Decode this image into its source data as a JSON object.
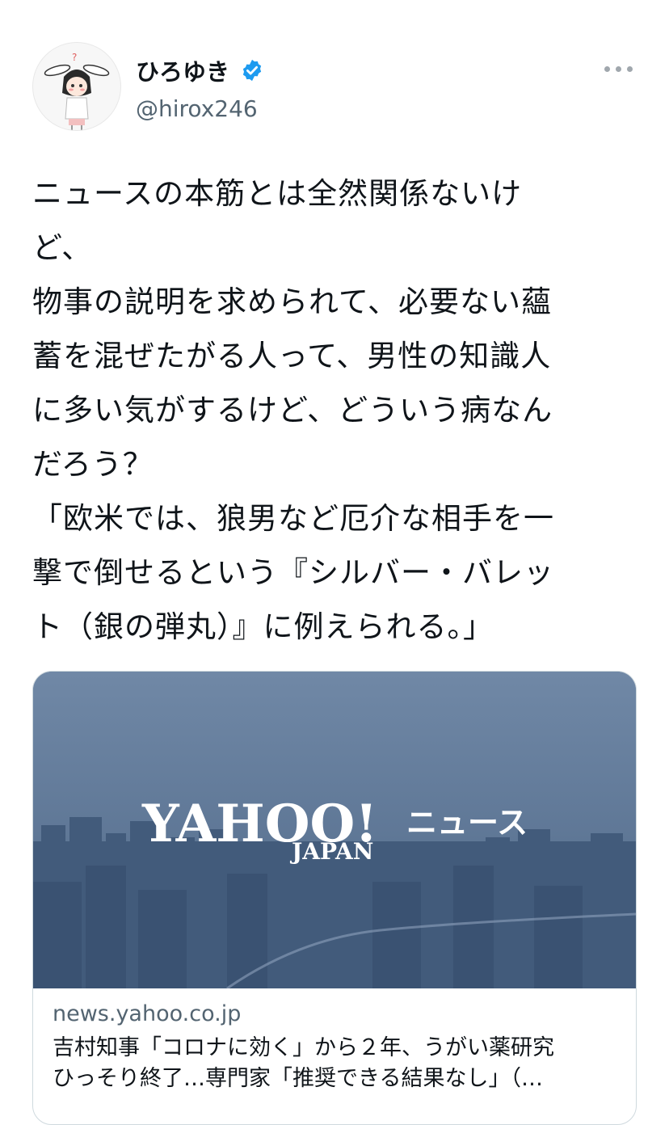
{
  "user": {
    "display_name": "ひろゆき",
    "handle": "@hirox246",
    "verified": true,
    "avatar_icon": "character-avatar-icon"
  },
  "tweet": {
    "lines": [
      "ニュースの本筋とは全然関係ないけ",
      "ど、",
      "物事の説明を求められて、必要ない蘊",
      "蓄を混ぜたがる人って、男性の知識人",
      "に多い気がするけど、どういう病なん",
      "だろう？",
      "「欧米では、狼男など厄介な相手を一",
      "撃で倒せるという『シルバー・バレッ",
      "ト（銀の弾丸）』に例えられる。」"
    ]
  },
  "card": {
    "logo_main": "YAHOO!",
    "logo_sub": "JAPAN",
    "logo_news": "ニュース",
    "domain": "news.yahoo.co.jp",
    "title_lines": [
      "吉村知事「コロナに効く」から２年、うがい薬研究",
      "ひっそり終了…専門家「推奨できる結果なし」（…"
    ]
  },
  "colors": {
    "verified_blue": "#1d9bf0",
    "secondary_text": "#536471",
    "card_bg": "#58708f"
  }
}
